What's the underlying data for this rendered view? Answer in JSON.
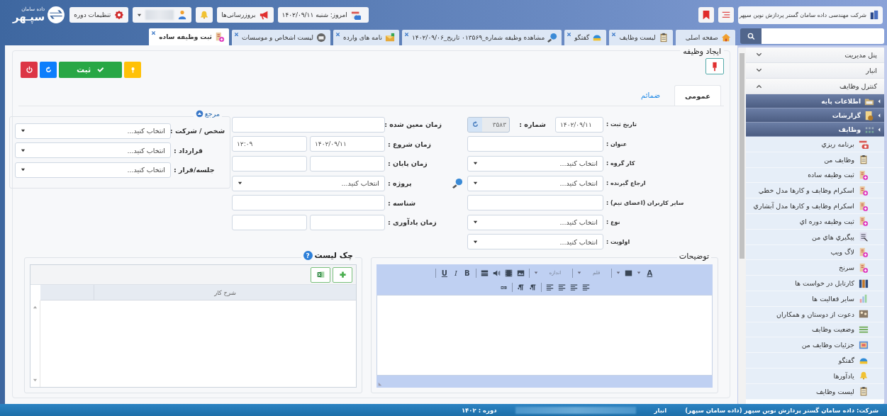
{
  "header": {
    "company": "شرکت مهندسی داده سامان گستر پردازش نوین سپهر",
    "logo": "سپـهر",
    "logo_caption": "داده سامان",
    "today": "امروز: شنبه ۱۴۰۲/۰۹/۱۱",
    "updates": "بروزرسانی‌ها",
    "period_settings": "تنظیمات دوره"
  },
  "tabs": [
    {
      "label": "صفحه اصلی",
      "kind": "home",
      "closable": false,
      "selected": false
    },
    {
      "label": "لیست وظایف",
      "kind": "clipboard",
      "closable": true,
      "selected": false
    },
    {
      "label": "گفتگو",
      "kind": "chat",
      "closable": true,
      "selected": false
    },
    {
      "label": "مشاهده وظیفه شماره_۰۱۳۵۶۹ تاریخ_۱۴۰۲/۰۹/۰۶",
      "kind": "magnifier",
      "closable": true,
      "selected": false
    },
    {
      "label": "نامه های وارده",
      "kind": "letters",
      "closable": true,
      "selected": false
    },
    {
      "label": "لیست اشخاص و موسسات",
      "kind": "contacts",
      "closable": true,
      "selected": false
    },
    {
      "label": "ثبت وظیفه ساده",
      "kind": "docplus",
      "closable": true,
      "selected": true
    }
  ],
  "sidebar": {
    "sections": [
      {
        "label": "پنل مدیریت",
        "expanded": false
      },
      {
        "label": "انبار",
        "expanded": false
      },
      {
        "label": "کنترل وظایف",
        "expanded": true
      }
    ],
    "groups": [
      {
        "label": "اطلاعات پایه",
        "kind": "folder"
      },
      {
        "label": "گزارشات",
        "kind": "report"
      },
      {
        "label": "وظایف",
        "kind": "dots"
      }
    ],
    "items": [
      {
        "label": "برنامه ریزي",
        "kind": "calendar"
      },
      {
        "label": "وظایف من",
        "kind": "clipboard"
      },
      {
        "label": "ثبت وظیفه ساده",
        "kind": "docplus"
      },
      {
        "label": "اسکرام وظایف و کارها مدل خطي",
        "kind": "docplus"
      },
      {
        "label": "اسکرام وظایف و کارها مدل آبشاري",
        "kind": "docplus"
      },
      {
        "label": "ثبت وظیفه دوره اي",
        "kind": "docplus"
      },
      {
        "label": "پیگیري هاي من",
        "kind": "checklist"
      },
      {
        "label": "لاگ ویپ",
        "kind": "docplus"
      },
      {
        "label": "سرنخ",
        "kind": "docplus"
      },
      {
        "label": "کارتابل در خواست ها",
        "kind": "binders"
      },
      {
        "label": "سایر فعالیت ها",
        "kind": "chart"
      },
      {
        "label": "دعوت از دوستان و همکاران",
        "kind": "people"
      },
      {
        "label": "وضعیت وظایف",
        "kind": "list"
      },
      {
        "label": "جزئیات وظایف من",
        "kind": "details"
      },
      {
        "label": "گفتگو",
        "kind": "chat"
      },
      {
        "label": "یادآورها",
        "kind": "bell"
      },
      {
        "label": "لیست وظایف",
        "kind": "clipboard"
      }
    ]
  },
  "form": {
    "title": "ایجاد وظیفه",
    "save": "ثبت",
    "subtabs": [
      {
        "label": "عمومی",
        "selected": true
      },
      {
        "label": "ضمائم",
        "selected": false
      }
    ],
    "column_1": [
      {
        "label": "تاریخ ثبت :",
        "controls": [
          {
            "kind": "date",
            "value": "۱۴۰۲/۰۹/۱۱"
          },
          {
            "kind": "label",
            "value": "شماره :"
          },
          {
            "kind": "counter",
            "value": "۳۵۸۳"
          }
        ]
      },
      {
        "label": "عنوان :",
        "controls": [
          {
            "kind": "input"
          }
        ]
      },
      {
        "label": "کار گروه :",
        "controls": [
          {
            "kind": "select",
            "placeholder": "انتخاب کنید..."
          }
        ]
      },
      {
        "label": "ارجاع گیرنده :",
        "controls": [
          {
            "kind": "lookup",
            "placeholder": "انتخاب کنید..."
          }
        ]
      },
      {
        "label": "سایر کاربران (اعضای تیم) :",
        "controls": [
          {
            "kind": "input"
          }
        ]
      },
      {
        "label": "نوع :",
        "controls": [
          {
            "kind": "select",
            "placeholder": "انتخاب کنید..."
          }
        ]
      },
      {
        "label": "اولویت :",
        "controls": [
          {
            "kind": "select",
            "placeholder": "انتخاب کنید..."
          }
        ]
      }
    ],
    "column_2": [
      {
        "label": "زمان معین شده :",
        "controls": [
          {
            "kind": "input"
          }
        ]
      },
      {
        "label": "زمان شروع :",
        "controls": [
          {
            "kind": "input",
            "value": "۱۴۰۲/۰۹/۱۱"
          },
          {
            "kind": "input",
            "value": "۱۲:۰۹"
          }
        ]
      },
      {
        "label": "زمان پایان :",
        "controls": [
          {
            "kind": "input"
          },
          {
            "kind": "input"
          }
        ]
      },
      {
        "label": "پروژه :",
        "controls": [
          {
            "kind": "select",
            "placeholder": "انتخاب کنید..."
          }
        ]
      },
      {
        "label": "شناسه :",
        "controls": [
          {
            "kind": "input"
          }
        ]
      },
      {
        "label": "زمان یادآوری :",
        "controls": [
          {
            "kind": "input"
          },
          {
            "kind": "input"
          }
        ]
      }
    ],
    "reference": {
      "title": "مرجع",
      "rows": [
        {
          "label": "شخص / شرکت :",
          "controls": [
            {
              "kind": "select",
              "placeholder": "انتخاب کنید..."
            }
          ]
        },
        {
          "label": "قرارداد :",
          "controls": [
            {
              "kind": "select",
              "placeholder": "انتخاب کنید..."
            }
          ]
        },
        {
          "label": "جلسه/قرار :",
          "controls": [
            {
              "kind": "select",
              "placeholder": "انتخاب کنید..."
            }
          ]
        }
      ]
    }
  },
  "editor": {
    "title": "توضیحات",
    "toolbar": [
      [
        {
          "kind": "color",
          "text": "A"
        },
        {
          "kind": "caret"
        },
        {
          "kind": "bgcolor"
        },
        {
          "kind": "caret"
        },
        {
          "kind": "sep"
        },
        {
          "kind": "font",
          "text": "قلم"
        },
        {
          "kind": "caret"
        },
        {
          "kind": "sep"
        },
        {
          "kind": "font",
          "text": "اندازه"
        },
        {
          "kind": "caret"
        },
        {
          "kind": "sep"
        },
        {
          "kind": "image"
        },
        {
          "kind": "video"
        },
        {
          "kind": "audio"
        },
        {
          "kind": "hr"
        },
        {
          "kind": "sep"
        },
        {
          "kind": "bold",
          "text": "B"
        },
        {
          "kind": "italic",
          "text": "I"
        },
        {
          "kind": "underline",
          "text": "U"
        },
        {
          "kind": "sep"
        }
      ],
      [
        {
          "kind": "align"
        },
        {
          "kind": "align"
        },
        {
          "kind": "align"
        },
        {
          "kind": "align"
        },
        {
          "kind": "sep"
        },
        {
          "kind": "paragraph"
        },
        {
          "kind": "paragraph"
        },
        {
          "kind": "sep"
        },
        {
          "kind": "link"
        }
      ]
    ]
  },
  "checklist": {
    "title": "چک لیست",
    "help": "?",
    "columns": [
      "شرح کار"
    ]
  },
  "status_bar": {
    "company": "شرکت: داده سامان گستر پردازش نوین سپهر (داده سامان سپهر)",
    "warehouse": "انبار",
    "period": "دوره : ۱۴۰۲"
  }
}
